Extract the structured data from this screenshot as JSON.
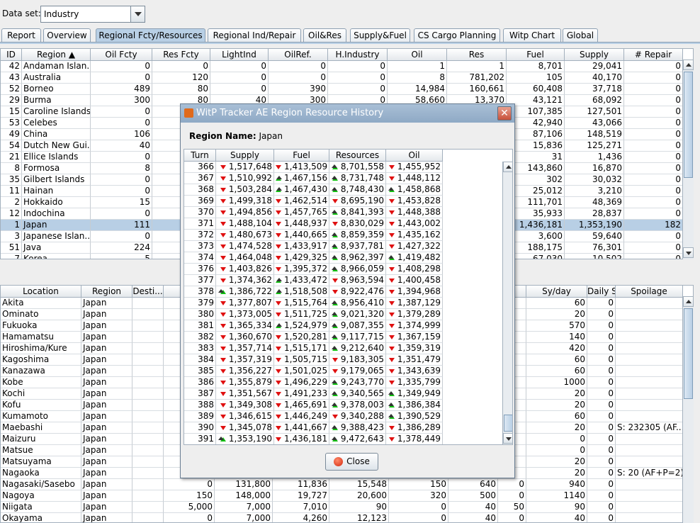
{
  "dataset": {
    "label": "Data set:",
    "value": "Industry"
  },
  "tabs": [
    "Report",
    "Overview",
    "Regional Fcty/Resources",
    "Regional Ind/Repair",
    "Oil&Res",
    "Supply&Fuel",
    "CS Cargo Planning",
    "Witp Chart",
    "Global"
  ],
  "upper": {
    "headers": [
      "ID",
      "Region ▲",
      "Oil Fcty",
      "Res Fcty",
      "LightInd",
      "OilRef.",
      "H.Industry",
      "Oil",
      "Res",
      "Fuel",
      "Supply",
      "# Repair"
    ],
    "rows": [
      [
        "42",
        "Andaman Islan...",
        "0",
        "0",
        "0",
        "0",
        "0",
        "1",
        "1",
        "8,701",
        "29,041",
        "0"
      ],
      [
        "43",
        "Australia",
        "0",
        "120",
        "0",
        "0",
        "0",
        "8",
        "781,202",
        "105",
        "40,170",
        "0"
      ],
      [
        "52",
        "Borneo",
        "489",
        "80",
        "0",
        "390",
        "0",
        "14,984",
        "160,661",
        "60,408",
        "37,718",
        "0"
      ],
      [
        "29",
        "Burma",
        "300",
        "80",
        "40",
        "300",
        "0",
        "58,660",
        "13,370",
        "43,121",
        "68,092",
        "0"
      ],
      [
        "15",
        "Caroline Islands",
        "0",
        "",
        "",
        "",
        "",
        "",
        "",
        "107,385",
        "127,501",
        "0"
      ],
      [
        "53",
        "Celebes",
        "0",
        "",
        "",
        "",
        "",
        "",
        "",
        "42,940",
        "43,066",
        "0"
      ],
      [
        "49",
        "China",
        "106",
        "",
        "",
        "",
        "",
        "",
        "",
        "87,106",
        "148,519",
        "0"
      ],
      [
        "54",
        "Dutch New Gui...",
        "40",
        "",
        "",
        "",
        "",
        "",
        "",
        "15,836",
        "125,271",
        "0"
      ],
      [
        "21",
        "Ellice Islands",
        "0",
        "",
        "",
        "",
        "",
        "",
        "",
        "31",
        "1,436",
        "0"
      ],
      [
        "8",
        "Formosa",
        "8",
        "",
        "",
        "",
        "",
        "",
        "",
        "143,860",
        "16,870",
        "0"
      ],
      [
        "35",
        "Gilbert Islands",
        "0",
        "",
        "",
        "",
        "",
        "",
        "",
        "302",
        "30,032",
        "0"
      ],
      [
        "11",
        "Hainan",
        "0",
        "",
        "",
        "",
        "",
        "",
        "",
        "25,012",
        "3,210",
        "0"
      ],
      [
        "2",
        "Hokkaido",
        "15",
        "",
        "",
        "",
        "",
        "",
        "",
        "111,701",
        "48,369",
        "0"
      ],
      [
        "12",
        "Indochina",
        "0",
        "",
        "",
        "",
        "",
        "",
        "",
        "35,933",
        "28,837",
        "0"
      ],
      [
        "1",
        "Japan",
        "111",
        "",
        "",
        "",
        "",
        "",
        "",
        "1,436,181",
        "1,353,190",
        "182"
      ],
      [
        "3",
        "Japanese Islan...",
        "0",
        "",
        "",
        "",
        "",
        "",
        "",
        "3,600",
        "59,640",
        "0"
      ],
      [
        "51",
        "Java",
        "224",
        "",
        "",
        "",
        "",
        "",
        "",
        "188,175",
        "76,301",
        "0"
      ],
      [
        "7",
        "Korea",
        "5",
        "",
        "",
        "",
        "",
        "",
        "",
        "67,030",
        "10,502",
        "0"
      ]
    ]
  },
  "lower": {
    "headers": [
      "Location",
      "Region",
      "Desti...",
      "",
      "",
      "",
      "",
      "",
      "",
      "",
      "Sy/day",
      "Daily Sy",
      "Spoilage"
    ],
    "rows": [
      [
        "Akita",
        "Japan",
        "",
        "",
        "",
        "",
        "",
        "",
        "",
        "",
        "60",
        "0",
        ""
      ],
      [
        "Ominato",
        "Japan",
        "",
        "",
        "",
        "",
        "",
        "",
        "",
        "",
        "20",
        "0",
        ""
      ],
      [
        "Fukuoka",
        "Japan",
        "",
        "",
        "",
        "",
        "",
        "",
        "",
        "",
        "570",
        "0",
        ""
      ],
      [
        "Hamamatsu",
        "Japan",
        "",
        "",
        "",
        "",
        "",
        "",
        "",
        "",
        "140",
        "0",
        ""
      ],
      [
        "Hiroshima/Kure",
        "Japan",
        "",
        "",
        "",
        "",
        "",
        "",
        "",
        "",
        "420",
        "0",
        ""
      ],
      [
        "Kagoshima",
        "Japan",
        "",
        "",
        "",
        "",
        "",
        "",
        "",
        "",
        "60",
        "0",
        ""
      ],
      [
        "Kanazawa",
        "Japan",
        "",
        "",
        "",
        "",
        "",
        "",
        "",
        "",
        "60",
        "0",
        ""
      ],
      [
        "Kobe",
        "Japan",
        "",
        "",
        "",
        "",
        "",
        "",
        "",
        "",
        "1000",
        "0",
        ""
      ],
      [
        "Kochi",
        "Japan",
        "",
        "",
        "",
        "",
        "",
        "",
        "",
        "",
        "20",
        "0",
        ""
      ],
      [
        "Kofu",
        "Japan",
        "",
        "",
        "",
        "",
        "",
        "",
        "",
        "",
        "20",
        "0",
        ""
      ],
      [
        "Kumamoto",
        "Japan",
        "",
        "",
        "",
        "",
        "",
        "",
        "",
        "",
        "60",
        "0",
        ""
      ],
      [
        "Maebashi",
        "Japan",
        "",
        "",
        "",
        "",
        "",
        "",
        "",
        "",
        "20",
        "0",
        "S: 232305 (AF..."
      ],
      [
        "Maizuru",
        "Japan",
        "",
        "",
        "",
        "",
        "",
        "",
        "",
        "",
        "0",
        "0",
        ""
      ],
      [
        "Matsue",
        "Japan",
        "",
        "",
        "",
        "",
        "",
        "",
        "",
        "",
        "0",
        "0",
        ""
      ],
      [
        "Matsuyama",
        "Japan",
        "",
        "",
        "",
        "",
        "",
        "",
        "",
        "",
        "20",
        "0",
        ""
      ],
      [
        "Nagaoka",
        "Japan",
        "",
        "",
        "",
        "",
        "",
        "",
        "",
        "",
        "20",
        "0",
        "S: 20 (AF+P=2)"
      ],
      [
        "Nagasaki/Sasebo",
        "Japan",
        "",
        "0",
        "131,800",
        "11,836",
        "15,548",
        "150",
        "640",
        "0",
        "940",
        "0",
        ""
      ],
      [
        "Nagoya",
        "Japan",
        "",
        "150",
        "148,000",
        "19,727",
        "20,600",
        "320",
        "500",
        "0",
        "1140",
        "0",
        ""
      ],
      [
        "Niigata",
        "Japan",
        "",
        "5,000",
        "7,000",
        "7,010",
        "90",
        "0",
        "40",
        "50",
        "90",
        "0",
        ""
      ],
      [
        "Okayama",
        "Japan",
        "",
        "0",
        "7,000",
        "4,260",
        "12,123",
        "0",
        "40",
        "0",
        "40",
        "0",
        ""
      ]
    ]
  },
  "dialog": {
    "title": "WitP Tracker AE Region Resource History",
    "region_label": "Region Name:",
    "region_value": "Japan",
    "headers": [
      "Turn",
      "Supply",
      "Fuel",
      "Resources",
      "Oil"
    ],
    "rows": [
      [
        "366",
        "down",
        "1,517,648",
        "down",
        "1,413,509",
        "up",
        "8,701,558",
        "down",
        "1,455,952"
      ],
      [
        "367",
        "down",
        "1,510,992",
        "up",
        "1,467,156",
        "up",
        "8,731,748",
        "down",
        "1,448,112"
      ],
      [
        "368",
        "down",
        "1,503,284",
        "up",
        "1,467,430",
        "up",
        "8,748,430",
        "up",
        "1,458,868"
      ],
      [
        "369",
        "down",
        "1,499,318",
        "down",
        "1,462,514",
        "down",
        "8,695,190",
        "down",
        "1,453,828"
      ],
      [
        "370",
        "down",
        "1,494,856",
        "down",
        "1,457,765",
        "up",
        "8,841,393",
        "down",
        "1,448,388"
      ],
      [
        "371",
        "down",
        "1,488,104",
        "down",
        "1,448,937",
        "down",
        "8,830,029",
        "down",
        "1,443,002"
      ],
      [
        "372",
        "down",
        "1,480,673",
        "down",
        "1,440,665",
        "up",
        "8,859,359",
        "down",
        "1,435,162"
      ],
      [
        "373",
        "down",
        "1,474,528",
        "down",
        "1,433,917",
        "up",
        "8,937,781",
        "down",
        "1,427,322"
      ],
      [
        "374",
        "down",
        "1,464,048",
        "down",
        "1,429,325",
        "up",
        "8,962,397",
        "up",
        "1,419,482"
      ],
      [
        "376",
        "down",
        "1,403,826",
        "down",
        "1,395,372",
        "up",
        "8,966,059",
        "down",
        "1,408,298"
      ],
      [
        "377",
        "down",
        "1,374,362",
        "up",
        "1,433,472",
        "down",
        "8,963,594",
        "down",
        "1,400,458"
      ],
      [
        "378",
        "up",
        "1,386,722",
        "up",
        "1,518,508",
        "down",
        "8,922,476",
        "down",
        "1,394,968"
      ],
      [
        "379",
        "down",
        "1,377,807",
        "down",
        "1,515,764",
        "up",
        "8,956,410",
        "down",
        "1,387,129"
      ],
      [
        "380",
        "down",
        "1,373,005",
        "down",
        "1,511,725",
        "up",
        "9,021,320",
        "down",
        "1,379,289"
      ],
      [
        "381",
        "down",
        "1,365,334",
        "up",
        "1,524,979",
        "up",
        "9,087,355",
        "down",
        "1,374,999"
      ],
      [
        "382",
        "down",
        "1,360,670",
        "down",
        "1,520,281",
        "up",
        "9,117,715",
        "down",
        "1,367,159"
      ],
      [
        "383",
        "down",
        "1,357,714",
        "down",
        "1,515,171",
        "up",
        "9,212,640",
        "down",
        "1,359,319"
      ],
      [
        "384",
        "down",
        "1,357,319",
        "down",
        "1,505,715",
        "down",
        "9,183,305",
        "down",
        "1,351,479"
      ],
      [
        "385",
        "down",
        "1,356,227",
        "down",
        "1,501,025",
        "down",
        "9,179,065",
        "down",
        "1,343,639"
      ],
      [
        "386",
        "down",
        "1,355,879",
        "down",
        "1,496,229",
        "up",
        "9,243,770",
        "down",
        "1,335,799"
      ],
      [
        "387",
        "down",
        "1,351,567",
        "down",
        "1,491,233",
        "up",
        "9,340,565",
        "up",
        "1,349,949"
      ],
      [
        "388",
        "down",
        "1,349,308",
        "down",
        "1,465,691",
        "up",
        "9,378,003",
        "up",
        "1,386,384"
      ],
      [
        "389",
        "down",
        "1,346,615",
        "down",
        "1,446,249",
        "down",
        "9,340,288",
        "up",
        "1,390,529"
      ],
      [
        "390",
        "down",
        "1,345,078",
        "down",
        "1,441,667",
        "up",
        "9,388,423",
        "down",
        "1,386,289"
      ],
      [
        "391",
        "up",
        "1,353,190",
        "down",
        "1,436,181",
        "up",
        "9,472,643",
        "down",
        "1,378,449"
      ]
    ],
    "close_label": "Close"
  }
}
